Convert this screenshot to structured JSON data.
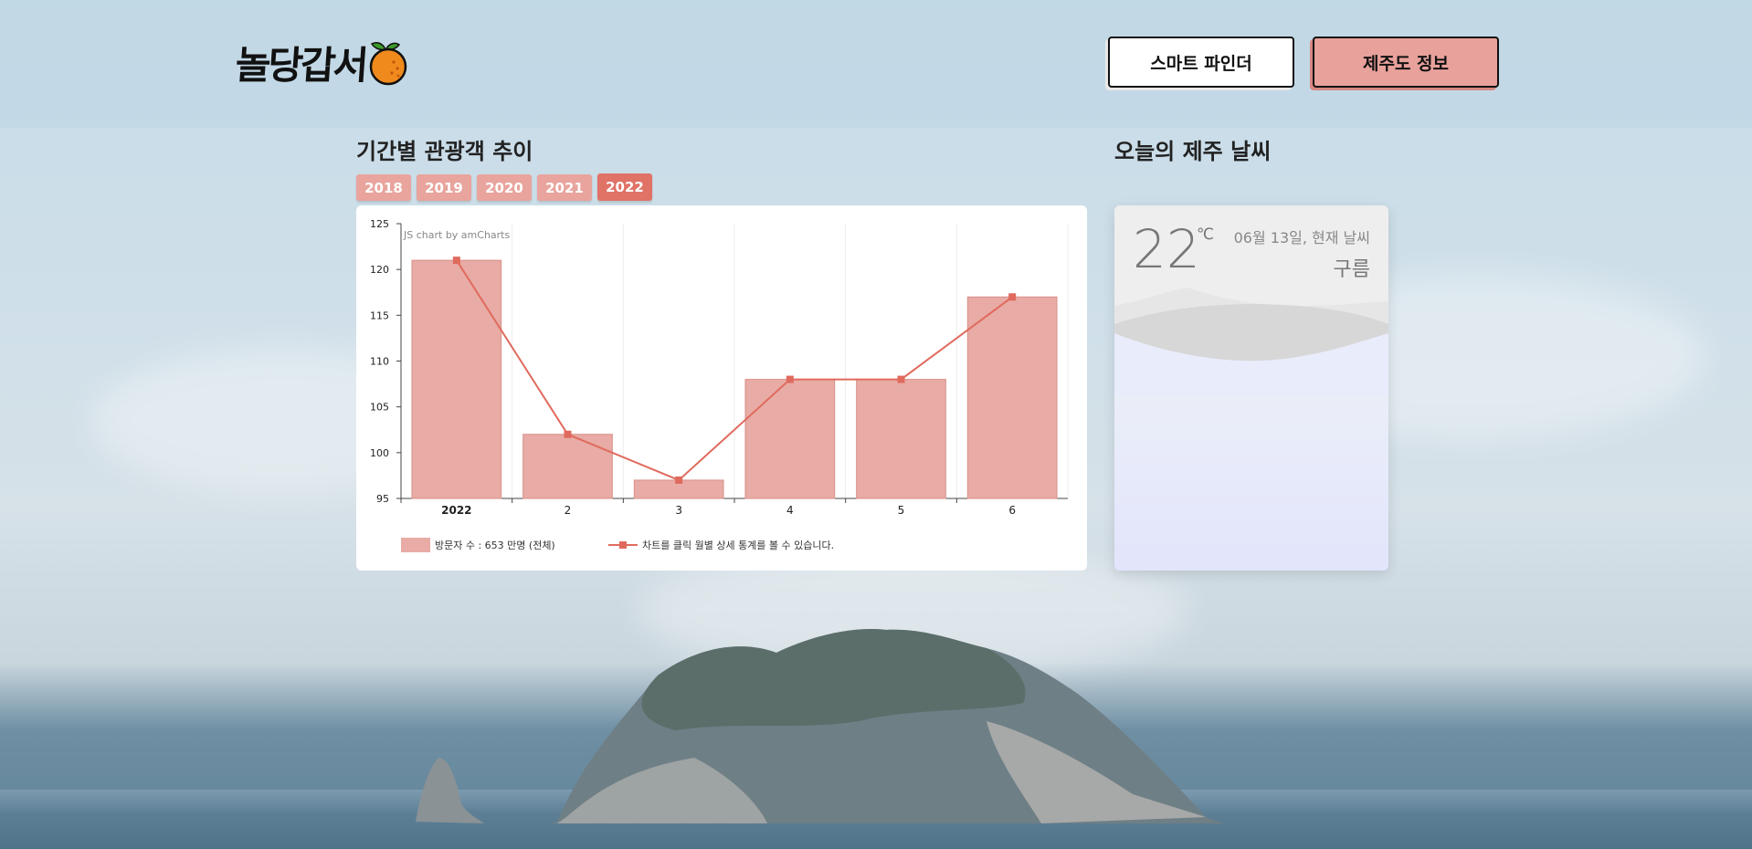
{
  "header": {
    "logo_text": "놀당갑서",
    "buttons": [
      {
        "label": "스마트 파인더"
      },
      {
        "label": "제주도 정보"
      }
    ]
  },
  "visitors": {
    "title": "기간별 관광객 추이",
    "years": [
      "2018",
      "2019",
      "2020",
      "2021",
      "2022"
    ],
    "selected_year": "2022"
  },
  "weather": {
    "title": "오늘의 제주 날씨",
    "temperature": "22",
    "unit": "℃",
    "date_text": "06월 13일, 현재 날씨",
    "condition": "구름"
  },
  "colors": {
    "accent": "#e07266",
    "bar": "#e8aba5",
    "line": "#e06a5d"
  },
  "chart_data": {
    "type": "bar",
    "credit": "JS chart by amCharts",
    "categories": [
      "2022",
      "2",
      "3",
      "4",
      "5",
      "6"
    ],
    "series": [
      {
        "name": "방문자 수 : 653 만명 (전체)",
        "type": "bar",
        "values": [
          121,
          102,
          97,
          108,
          108,
          117
        ]
      },
      {
        "name": "차트를 클릭 월별 상세 통계를 볼 수 있습니다.",
        "type": "line",
        "values": [
          121,
          102,
          97,
          108,
          108,
          117
        ]
      }
    ],
    "ylim": [
      95,
      125
    ],
    "yticks": [
      95,
      100,
      105,
      110,
      115,
      120,
      125
    ],
    "grid": true,
    "legend": "bottom-left"
  }
}
